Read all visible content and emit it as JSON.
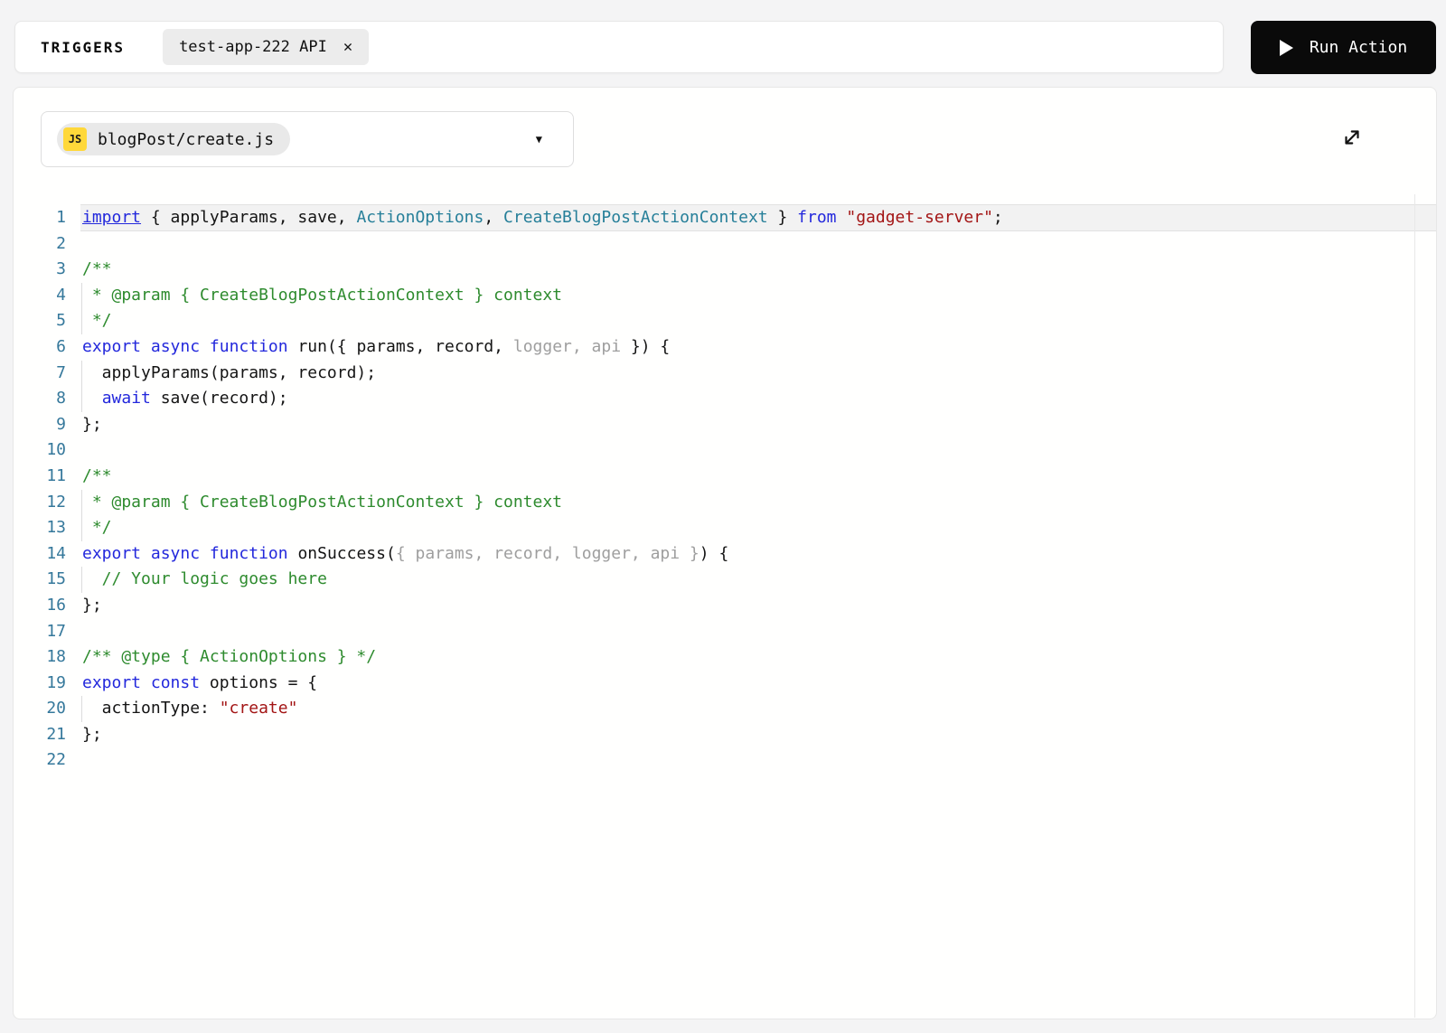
{
  "icons": {
    "play": "play",
    "remove": "✕",
    "caret": "▼",
    "file_badge": "JS",
    "expand": "expand-diagonal"
  },
  "toolbar": {
    "triggers_label": "TRIGGERS",
    "trigger_chip": {
      "label": "test-app-222 API"
    },
    "run_button": {
      "label": "Run Action"
    }
  },
  "editor": {
    "file_selector": {
      "file_name": "blogPost/create.js",
      "file_icon": "JS"
    },
    "colors": {
      "keyword": "#2328dc",
      "type": "#267f99",
      "string": "#a31515",
      "comment": "#2e8b2e",
      "unused": "#9e9e9e",
      "line_number": "#35789b",
      "active_line_bg": "#f2f2f2",
      "run_button_bg": "#0a0a0a",
      "js_badge_bg": "#ffd83a",
      "chip_bg": "#ececec"
    },
    "code": {
      "language": "javascript",
      "lines": [
        {
          "n": 1,
          "hl": true,
          "segs": [
            [
              "kwu",
              "import"
            ],
            [
              "pl",
              " { applyParams, save, "
            ],
            [
              "ty",
              "ActionOptions"
            ],
            [
              "pl",
              ", "
            ],
            [
              "ty",
              "CreateBlogPostActionContext"
            ],
            [
              "pl",
              " } "
            ],
            [
              "kw",
              "from"
            ],
            [
              "pl",
              " "
            ],
            [
              "st",
              "\"gadget-server\""
            ],
            [
              "pl",
              ";"
            ]
          ]
        },
        {
          "n": 2,
          "segs": []
        },
        {
          "n": 3,
          "segs": [
            [
              "com",
              "/**"
            ]
          ]
        },
        {
          "n": 4,
          "g": true,
          "segs": [
            [
              "com",
              " * @param { CreateBlogPostActionContext } context"
            ]
          ]
        },
        {
          "n": 5,
          "g": true,
          "segs": [
            [
              "com",
              " */"
            ]
          ]
        },
        {
          "n": 6,
          "segs": [
            [
              "kw",
              "export"
            ],
            [
              "pl",
              " "
            ],
            [
              "kw",
              "async"
            ],
            [
              "pl",
              " "
            ],
            [
              "kw",
              "function"
            ],
            [
              "pl",
              " run({ params, record, "
            ],
            [
              "dim",
              "logger, api"
            ],
            [
              "pl",
              " }) {"
            ]
          ]
        },
        {
          "n": 7,
          "g": true,
          "segs": [
            [
              "pl",
              "  applyParams(params, record);"
            ]
          ]
        },
        {
          "n": 8,
          "g": true,
          "segs": [
            [
              "pl",
              "  "
            ],
            [
              "kw",
              "await"
            ],
            [
              "pl",
              " save(record);"
            ]
          ]
        },
        {
          "n": 9,
          "segs": [
            [
              "pl",
              "};"
            ]
          ]
        },
        {
          "n": 10,
          "segs": []
        },
        {
          "n": 11,
          "segs": [
            [
              "com",
              "/**"
            ]
          ]
        },
        {
          "n": 12,
          "g": true,
          "segs": [
            [
              "com",
              " * @param { CreateBlogPostActionContext } context"
            ]
          ]
        },
        {
          "n": 13,
          "g": true,
          "segs": [
            [
              "com",
              " */"
            ]
          ]
        },
        {
          "n": 14,
          "segs": [
            [
              "kw",
              "export"
            ],
            [
              "pl",
              " "
            ],
            [
              "kw",
              "async"
            ],
            [
              "pl",
              " "
            ],
            [
              "kw",
              "function"
            ],
            [
              "pl",
              " onSuccess("
            ],
            [
              "dim",
              "{ params, record, logger, api }"
            ],
            [
              "pl",
              ") {"
            ]
          ]
        },
        {
          "n": 15,
          "g": true,
          "segs": [
            [
              "com",
              "  // Your logic goes here"
            ]
          ]
        },
        {
          "n": 16,
          "segs": [
            [
              "pl",
              "};"
            ]
          ]
        },
        {
          "n": 17,
          "segs": []
        },
        {
          "n": 18,
          "segs": [
            [
              "com",
              "/** @type { ActionOptions } */"
            ]
          ]
        },
        {
          "n": 19,
          "segs": [
            [
              "kw",
              "export"
            ],
            [
              "pl",
              " "
            ],
            [
              "kw",
              "const"
            ],
            [
              "pl",
              " options = {"
            ]
          ]
        },
        {
          "n": 20,
          "g": true,
          "segs": [
            [
              "pl",
              "  actionType: "
            ],
            [
              "st",
              "\"create\""
            ]
          ]
        },
        {
          "n": 21,
          "segs": [
            [
              "pl",
              "};"
            ]
          ]
        },
        {
          "n": 22,
          "segs": []
        }
      ]
    }
  }
}
